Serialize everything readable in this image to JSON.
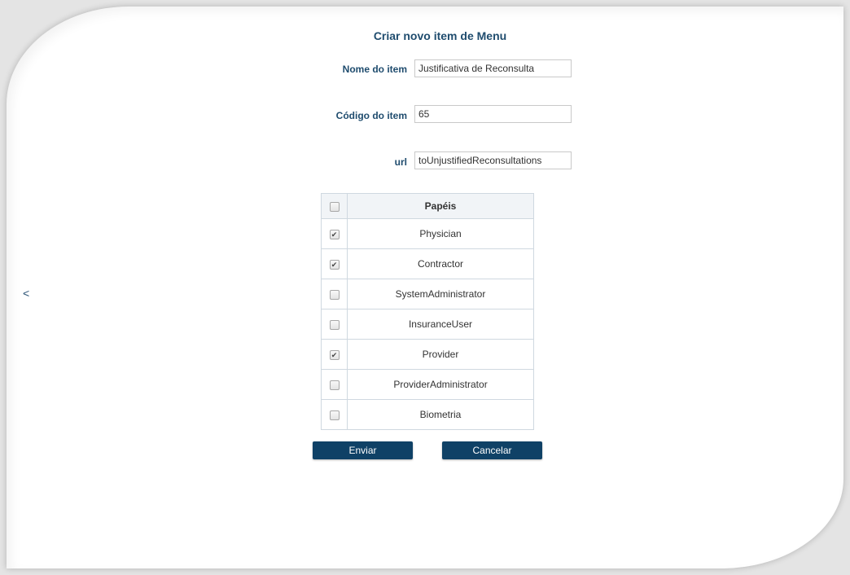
{
  "nav": {
    "back_label": "<"
  },
  "form": {
    "title": "Criar novo item de Menu",
    "fields": {
      "name": {
        "label": "Nome do item",
        "value": "Justificativa de Reconsulta"
      },
      "code": {
        "label": "Código do item",
        "value": "65"
      },
      "url": {
        "label": "url",
        "value": "toUnjustifiedReconsultations"
      }
    }
  },
  "roles_table": {
    "header": "Papéis",
    "header_checked": false,
    "rows": [
      {
        "name": "Physician",
        "checked": true
      },
      {
        "name": "Contractor",
        "checked": true
      },
      {
        "name": "SystemAdministrator",
        "checked": false
      },
      {
        "name": "InsuranceUser",
        "checked": false
      },
      {
        "name": "Provider",
        "checked": true
      },
      {
        "name": "ProviderAdministrator",
        "checked": false
      },
      {
        "name": "Biometria",
        "checked": false
      }
    ]
  },
  "buttons": {
    "submit": "Enviar",
    "cancel": "Cancelar"
  },
  "colors": {
    "primary": "#0f4166",
    "label": "#1f4c6e"
  }
}
